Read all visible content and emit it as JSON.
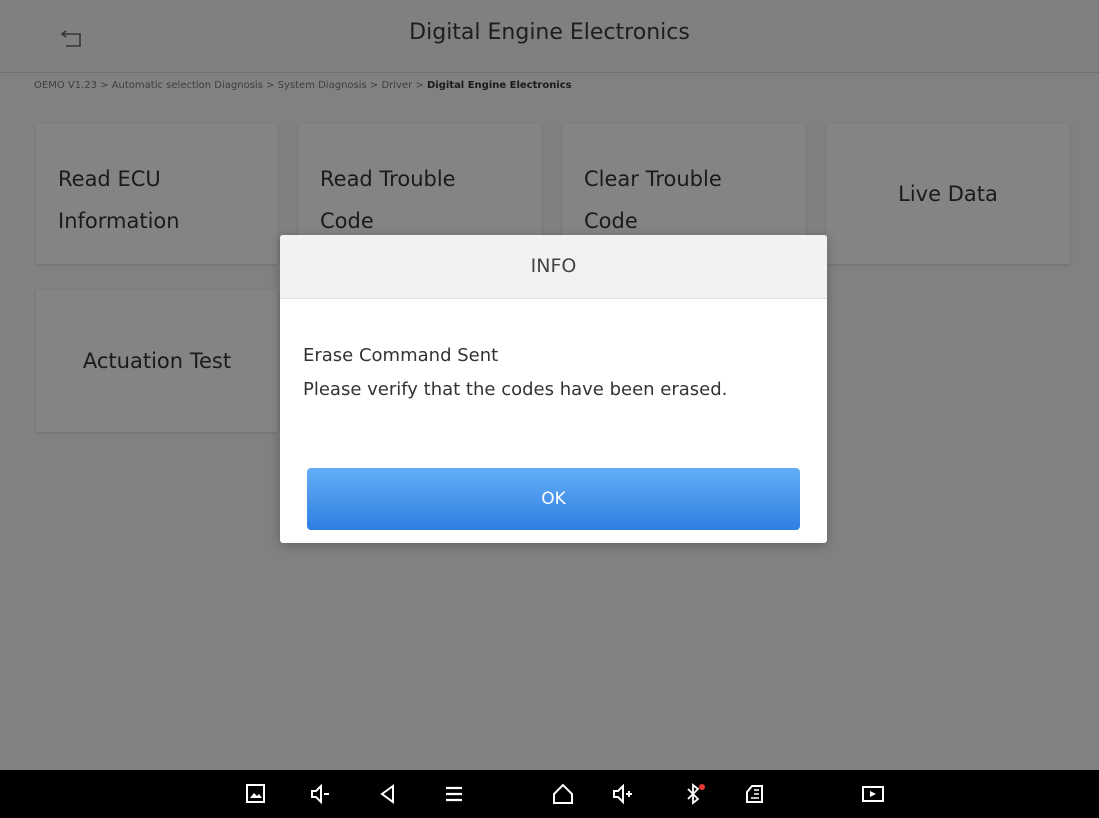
{
  "header": {
    "title": "Digital Engine Electronics",
    "back_icon": "back-arrow-icon"
  },
  "breadcrumb": {
    "path": "OEMO V1.23 > Automatic selection Diagnosis > System Diagnosis > Driver > ",
    "current": "Digital Engine Electronics"
  },
  "functions": [
    {
      "label": "Read ECU Information"
    },
    {
      "label": "Read Trouble Code"
    },
    {
      "label": "Clear Trouble Code"
    },
    {
      "label": "Live Data"
    },
    {
      "label": "Actuation Test"
    }
  ],
  "dialog": {
    "title": "INFO",
    "line1": "Erase Command Sent",
    "line2": "Please verify that the codes have been erased.",
    "ok_label": "OK",
    "ok_color": "#2f7ee2"
  },
  "navbar": {
    "icons": [
      "screenshot-icon",
      "volume-down-icon",
      "back-icon",
      "menu-icon",
      "home-icon",
      "volume-up-icon",
      "bluetooth-icon",
      "vci-icon",
      "screen-record-icon"
    ]
  }
}
